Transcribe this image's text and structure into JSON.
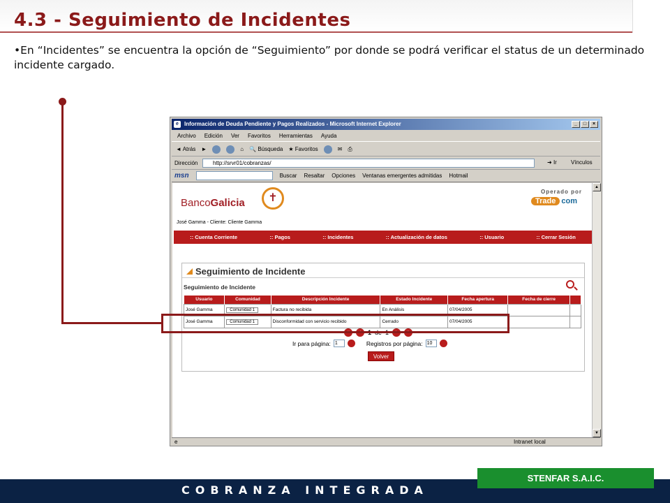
{
  "slide": {
    "title": "4.3 - Seguimiento de Incidentes",
    "intro": "•En “Incidentes” se encuentra la opción de “Seguimiento” por donde se podrá verificar el status de un determinado incidente cargado.",
    "footer": "COBRANZA INTEGRADA",
    "company": "STENFAR S.A.I.C."
  },
  "browser": {
    "window_title": "Información de Deuda Pendiente y Pagos Realizados - Microsoft Internet Explorer",
    "menu": [
      "Archivo",
      "Edición",
      "Ver",
      "Favoritos",
      "Herramientas",
      "Ayuda"
    ],
    "toolbar": {
      "back": "Atrás",
      "search": "Búsqueda",
      "favorites": "Favoritos"
    },
    "address_label": "Dirección",
    "address": "http://srvr01/cobranzas/",
    "go_label": "Ir",
    "links_label": "Vínculos",
    "msn": {
      "logo": "msn",
      "search": "Buscar",
      "highlight": "Resaltar",
      "options": "Opciones",
      "popups": "Ventanas emergentes admitidas",
      "hotmail": "Hotmail"
    },
    "status_zone": "Intranet local"
  },
  "site": {
    "bank_name_a": "Banco",
    "bank_name_b": "Galicia",
    "operated_by": "Operado por",
    "trade_a": "Trade",
    "trade_b": "com",
    "user_line": "José Gamma - Cliente: Cliente Gamma",
    "nav": [
      ":: Cuenta Corriente",
      ":: Pagos",
      ":: Incidentes",
      ":: Actualización de datos",
      ":: Usuario",
      ":: Cerrar Sesión"
    ],
    "panel_title": "Seguimiento de Incidente",
    "panel_subtitle": "Seguimiento de Incidente",
    "columns": [
      "Usuario",
      "Comunidad",
      "Descripción Incidente",
      "Estado Incidente",
      "Fecha apertura",
      "Fecha de cierre"
    ],
    "rows": [
      {
        "usuario": "José Gamma",
        "comunidad": "Comunidad 1",
        "descripcion": "Factura no recibida",
        "estado": "En Análisis",
        "apertura": "07/04/2005",
        "cierre": ""
      },
      {
        "usuario": "José Gamma",
        "comunidad": "Comunidad 1",
        "descripcion": "Disconformidad con servicio recibido",
        "estado": "Cerrado",
        "apertura": "07/04/2005",
        "cierre": ""
      }
    ],
    "pager": {
      "current": "1",
      "of_label": "de",
      "total": "1"
    },
    "goto_label": "Ir para página:",
    "goto_value": "1",
    "per_page_label": "Registros por página:",
    "per_page_value": "10",
    "back_button": "Volver"
  },
  "colors": {
    "title": "#8b1a1a",
    "nav": "#b81c1c",
    "footer": "#0b2244",
    "company": "#1a8f2e"
  }
}
